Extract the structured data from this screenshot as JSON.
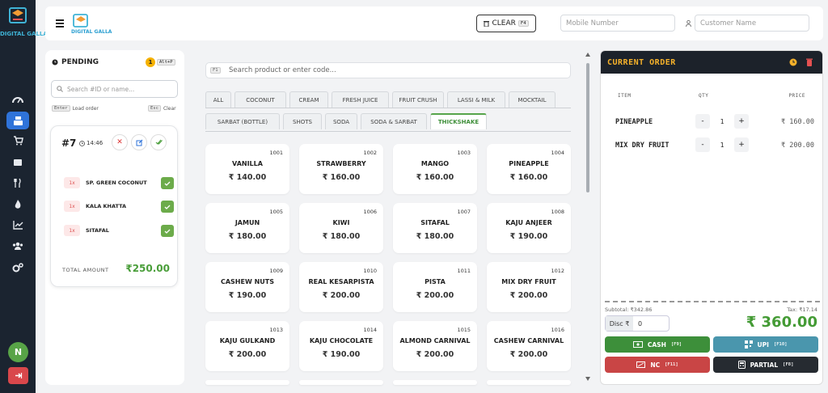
{
  "brand": {
    "name": "DIGITAL GALLA",
    "name_header": "DIGITAL GALLA"
  },
  "header": {
    "clear_label": "CLEAR",
    "clear_key": "F4",
    "mobile_placeholder": "Mobile Number",
    "customer_placeholder": "Customer Name"
  },
  "user": {
    "initial": "N"
  },
  "pending": {
    "title": "PENDING",
    "count": "1",
    "shortcut": "Alt+P",
    "search_placeholder": "Search #ID or name...",
    "tip_enter_key": "Enter",
    "tip_enter": "Load order",
    "tip_esc_key": "Esc",
    "tip_esc": "Clear",
    "order": {
      "number": "#7",
      "time": "14:46",
      "items": [
        {
          "qty": "1x",
          "name": "SP. GREEN COCONUT"
        },
        {
          "qty": "1x",
          "name": "KALA KHATTA"
        },
        {
          "qty": "1x",
          "name": "SITAFAL"
        }
      ],
      "total_label": "TOTAL AMOUNT",
      "total_value": "₹250.00"
    }
  },
  "products": {
    "search_key": "F1",
    "search_placeholder": "Search product or enter code...",
    "tabs_row1": [
      "ALL",
      "COCONUT",
      "CREAM",
      "FRESH JUICE",
      "FRUIT CRUSH",
      "LASSI & MILK",
      "MOCKTAIL"
    ],
    "tabs_row2": [
      "SARBAT (BOTTLE)",
      "SHOTS",
      "SODA",
      "SODA & SARBAT",
      "THICKSHAKE"
    ],
    "active_tab": "THICKSHAKE",
    "items": [
      {
        "code": "1001",
        "name": "VANILLA",
        "price": "₹ 140.00"
      },
      {
        "code": "1002",
        "name": "STRAWBERRY",
        "price": "₹ 160.00"
      },
      {
        "code": "1003",
        "name": "MANGO",
        "price": "₹ 160.00"
      },
      {
        "code": "1004",
        "name": "PINEAPPLE",
        "price": "₹ 160.00"
      },
      {
        "code": "1005",
        "name": "JAMUN",
        "price": "₹ 180.00"
      },
      {
        "code": "1006",
        "name": "KIWI",
        "price": "₹ 180.00"
      },
      {
        "code": "1007",
        "name": "SITAFAL",
        "price": "₹ 180.00"
      },
      {
        "code": "1008",
        "name": "KAJU ANJEER",
        "price": "₹ 190.00"
      },
      {
        "code": "1009",
        "name": "CASHEW NUTS",
        "price": "₹ 190.00"
      },
      {
        "code": "1010",
        "name": "REAL KESARPISTA",
        "price": "₹ 200.00"
      },
      {
        "code": "1011",
        "name": "PISTA",
        "price": "₹ 200.00"
      },
      {
        "code": "1012",
        "name": "MIX DRY FRUIT",
        "price": "₹ 200.00"
      },
      {
        "code": "1013",
        "name": "KAJU GULKAND",
        "price": "₹ 200.00"
      },
      {
        "code": "1014",
        "name": "KAJU CHOCOLATE",
        "price": "₹ 190.00"
      },
      {
        "code": "1015",
        "name": "ALMOND CARNIVAL",
        "price": "₹ 200.00"
      },
      {
        "code": "1016",
        "name": "CASHEW CARNIVAL",
        "price": "₹ 200.00"
      }
    ]
  },
  "order": {
    "title": "CURRENT ORDER",
    "col_item": "ITEM",
    "col_qty": "QTY",
    "col_price": "PRICE",
    "lines": [
      {
        "name": "PINEAPPLE",
        "qty": "1",
        "price": "₹ 160.00"
      },
      {
        "name": "MIX DRY FRUIT",
        "qty": "1",
        "price": "₹ 200.00"
      }
    ],
    "subtotal": "Subtotal: ₹342.86",
    "tax": "Tax: ₹17.14",
    "disc_label": "Disc ₹",
    "disc_value": "0",
    "grand_total": "₹ 360.00",
    "pay": [
      {
        "label": "CASH",
        "key": "[F9]",
        "color": "#3d8f3a"
      },
      {
        "label": "UPI",
        "key": "[F10]",
        "color": "#4a96ad"
      },
      {
        "label": "NC",
        "key": "[F11]",
        "color": "#c94545"
      },
      {
        "label": "PARTIAL",
        "key": "[F8]",
        "color": "#262b31"
      }
    ]
  }
}
